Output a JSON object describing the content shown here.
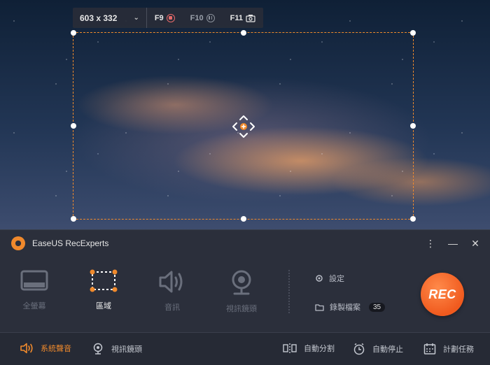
{
  "app": {
    "name": "EaseUS RecExperts"
  },
  "toolbar": {
    "size_value": "603 x 332",
    "hotkeys": [
      {
        "key": "F9",
        "icon": "record-icon"
      },
      {
        "key": "F10",
        "icon": "pause-icon"
      },
      {
        "key": "F11",
        "icon": "screenshot-icon"
      }
    ]
  },
  "modes": [
    {
      "label": "全螢幕",
      "icon": "fullscreen-icon",
      "active": false
    },
    {
      "label": "區域",
      "icon": "region-icon",
      "active": true
    },
    {
      "label": "音訊",
      "icon": "speaker-icon",
      "active": false
    },
    {
      "label": "視訊鏡頭",
      "icon": "webcam-icon",
      "active": false
    }
  ],
  "side": {
    "settings_label": "設定",
    "recordings_label": "錄製檔案",
    "recordings_count": "35"
  },
  "rec_label": "REC",
  "footer": {
    "system_sound": "系統聲音",
    "webcam": "視訊鏡頭",
    "auto_split": "自動分割",
    "auto_stop": "自動停止",
    "schedule": "計劃任務"
  },
  "colors": {
    "accent": "#f08a2c",
    "rec": "#f05a1e",
    "panel": "#2b2f3b"
  }
}
